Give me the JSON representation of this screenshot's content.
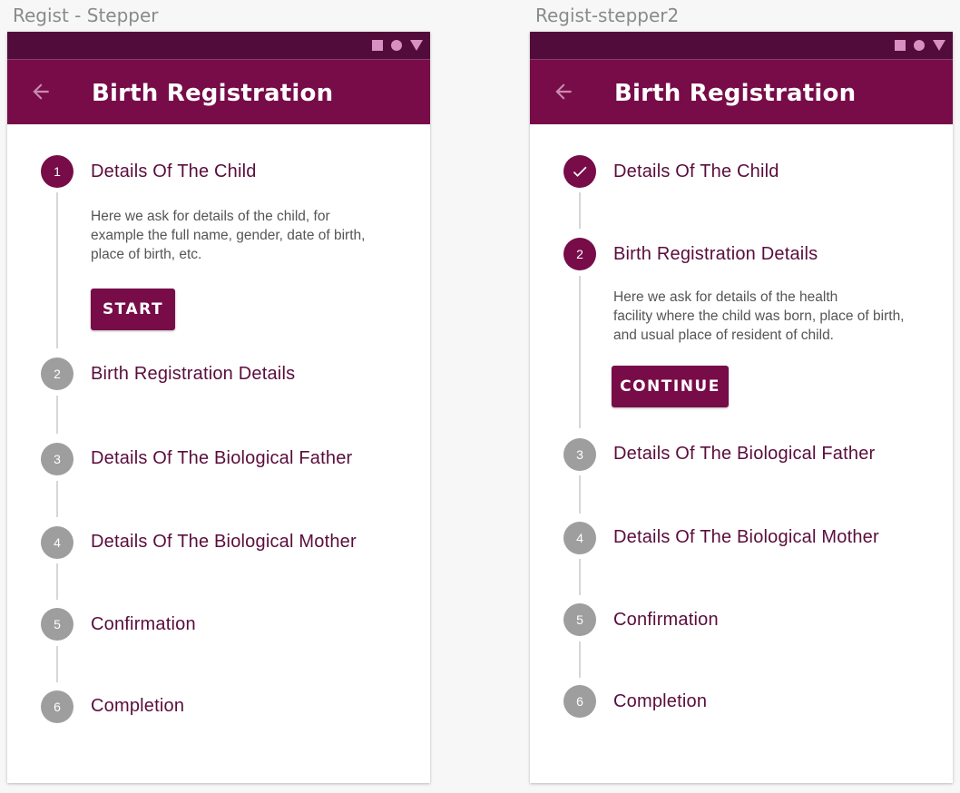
{
  "colors": {
    "primary": "#770c48",
    "statusbar": "#510c3b",
    "inactive_step": "#9e9e9e",
    "step_text": "#5a0d3c"
  },
  "screens": [
    {
      "artboard_label": "Regist - Stepper",
      "appbar": {
        "back_icon": "arrow-left-icon",
        "title": "Birth Registration"
      },
      "steps": [
        {
          "number": "1",
          "label": "Details Of The Child",
          "state": "active"
        },
        {
          "number": "2",
          "label": "Birth Registration Details",
          "state": "inactive"
        },
        {
          "number": "3",
          "label": "Details Of The Biological Father",
          "state": "inactive"
        },
        {
          "number": "4",
          "label": "Details Of The Biological Mother",
          "state": "inactive"
        },
        {
          "number": "5",
          "label": "Confirmation",
          "state": "inactive"
        },
        {
          "number": "6",
          "label": "Completion",
          "state": "inactive"
        }
      ],
      "active_content": {
        "description_lines": [
          "Here we ask for details of the child, for",
          "example the full name, gender, date of birth,",
          "place of birth, etc."
        ],
        "button_label": "START"
      }
    },
    {
      "artboard_label": "Regist-stepper2",
      "appbar": {
        "back_icon": "arrow-left-icon",
        "title": "Birth Registration"
      },
      "steps": [
        {
          "number": "",
          "label": "Details Of The Child",
          "state": "completed",
          "icon": "check-icon"
        },
        {
          "number": "2",
          "label": "Birth Registration Details",
          "state": "active"
        },
        {
          "number": "3",
          "label": "Details Of The Biological Father",
          "state": "inactive"
        },
        {
          "number": "4",
          "label": "Details Of The Biological Mother",
          "state": "inactive"
        },
        {
          "number": "5",
          "label": "Confirmation",
          "state": "inactive"
        },
        {
          "number": "6",
          "label": "Completion",
          "state": "inactive"
        }
      ],
      "active_content": {
        "description_lines": [
          "Here we ask for details of the health",
          "facility where the child was born, place of birth,",
          "and usual place of resident of child."
        ],
        "button_label": "CONTINUE"
      }
    }
  ]
}
